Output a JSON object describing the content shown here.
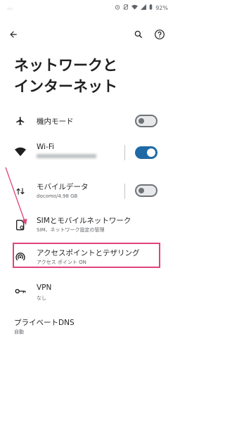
{
  "status_bar": {
    "time": "…",
    "battery": "92%"
  },
  "toolbar": {
    "back_icon": "arrow-back-icon",
    "search_icon": "search-icon",
    "help_icon": "help-icon"
  },
  "page": {
    "title_line1": "ネットワークと",
    "title_line2": "インターネット"
  },
  "items": [
    {
      "title": "機内モード",
      "icon": "airplane-icon",
      "toggle": "off"
    },
    {
      "title": "Wi-Fi",
      "subtitle": "",
      "icon": "wifi-icon",
      "toggle": "on"
    },
    {
      "title": "モバイルデータ",
      "subtitle": "docomo/4.98 GB",
      "icon": "mobile-data-icon",
      "toggle": "off"
    },
    {
      "title": "SIMとモバイルネットワーク",
      "subtitle": "SIM、ネットワーク設定の管理",
      "icon": "sim-settings-icon"
    },
    {
      "title": "アクセスポイントとテザリング",
      "subtitle": "アクセス ポイント ON",
      "icon": "hotspot-icon"
    },
    {
      "title": "VPN",
      "subtitle": "なし",
      "icon": "vpn-key-icon"
    },
    {
      "title": "プライベートDNS",
      "subtitle": "自動"
    }
  ],
  "colors": {
    "highlight": "#e0437c",
    "toggle_on": "#1f6aa5"
  }
}
